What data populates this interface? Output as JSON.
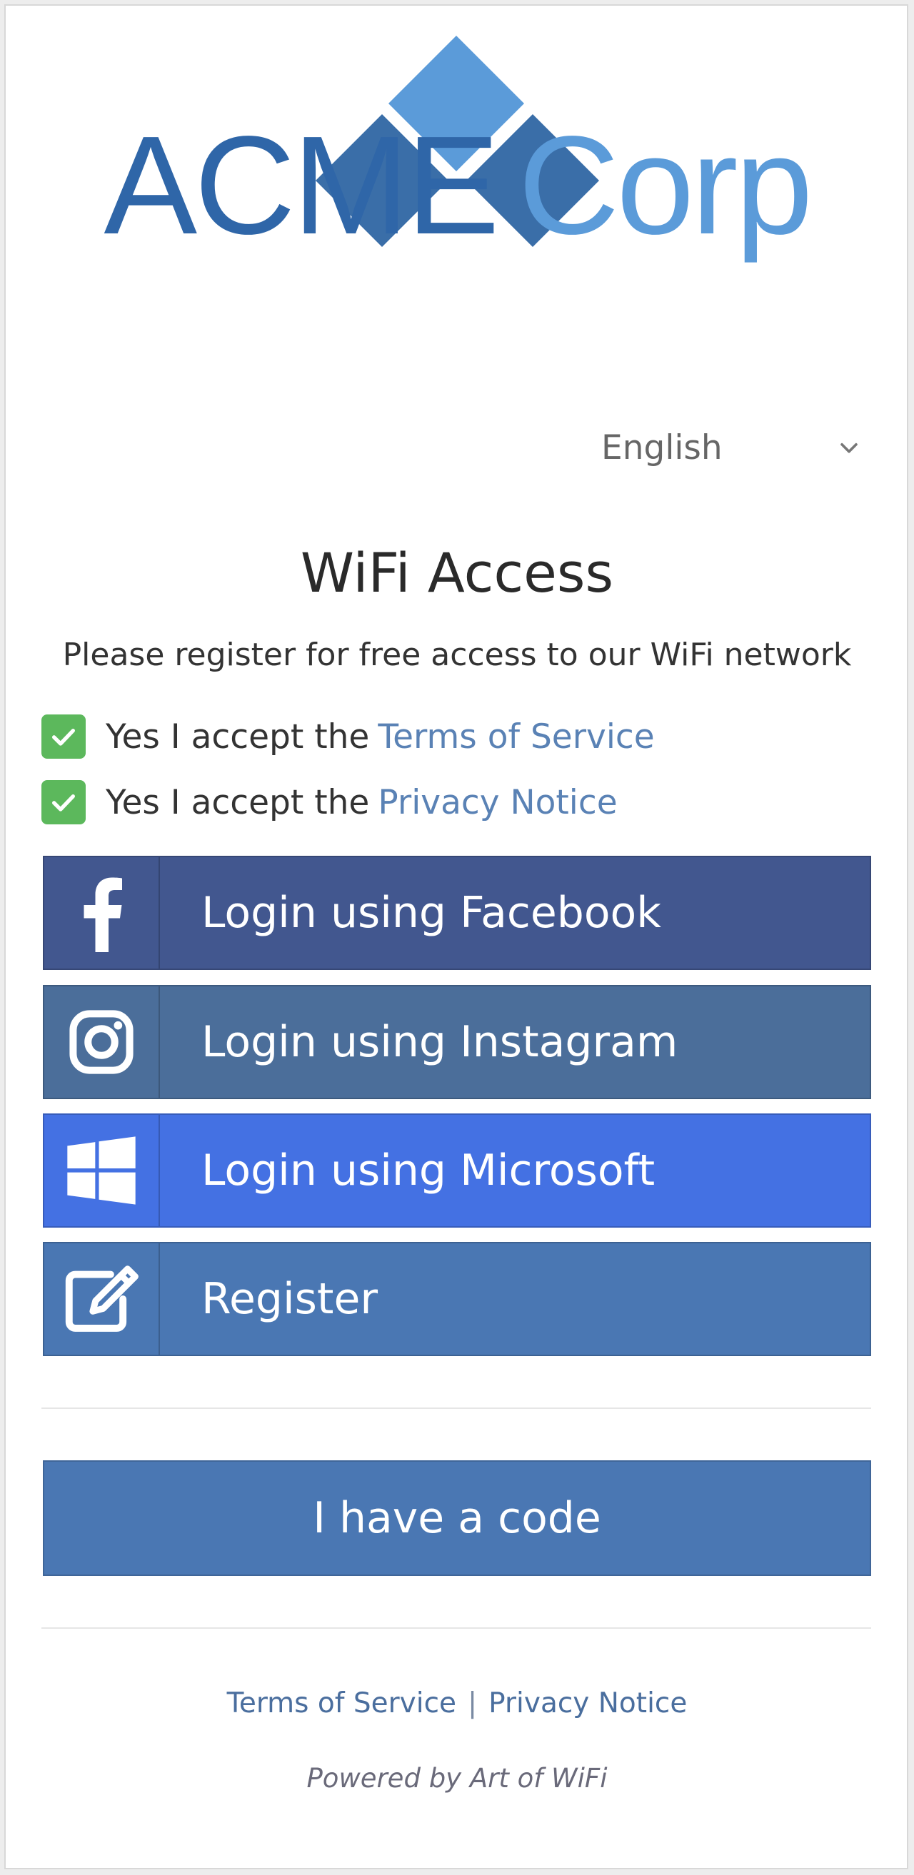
{
  "logo": {
    "word1": "ACME",
    "word2": "Corp",
    "colors": {
      "dark": "#2f66a8",
      "light": "#5b9bd9"
    }
  },
  "language": {
    "selected": "English",
    "icon": "chevron-down-icon"
  },
  "title": "WiFi Access",
  "subtitle": "Please register for free access to our WiFi network",
  "consents": [
    {
      "prefix": "Yes I accept the",
      "link": "Terms of Service",
      "checked": true
    },
    {
      "prefix": "Yes I accept the",
      "link": "Privacy Notice",
      "checked": true
    }
  ],
  "login_buttons": [
    {
      "label": "Login using Facebook",
      "icon": "facebook-icon",
      "color": "#42578f"
    },
    {
      "label": "Login using Instagram",
      "icon": "instagram-icon",
      "color": "#4b6e9a"
    },
    {
      "label": "Login using Microsoft",
      "icon": "windows-icon",
      "color": "#4471e3"
    },
    {
      "label": "Register",
      "icon": "edit-icon",
      "color": "#4a77b3"
    }
  ],
  "code_button": "I have a code",
  "footer": {
    "terms": "Terms of Service",
    "separator": "|",
    "privacy": "Privacy Notice",
    "powered_by": "Powered by Art of WiFi"
  }
}
